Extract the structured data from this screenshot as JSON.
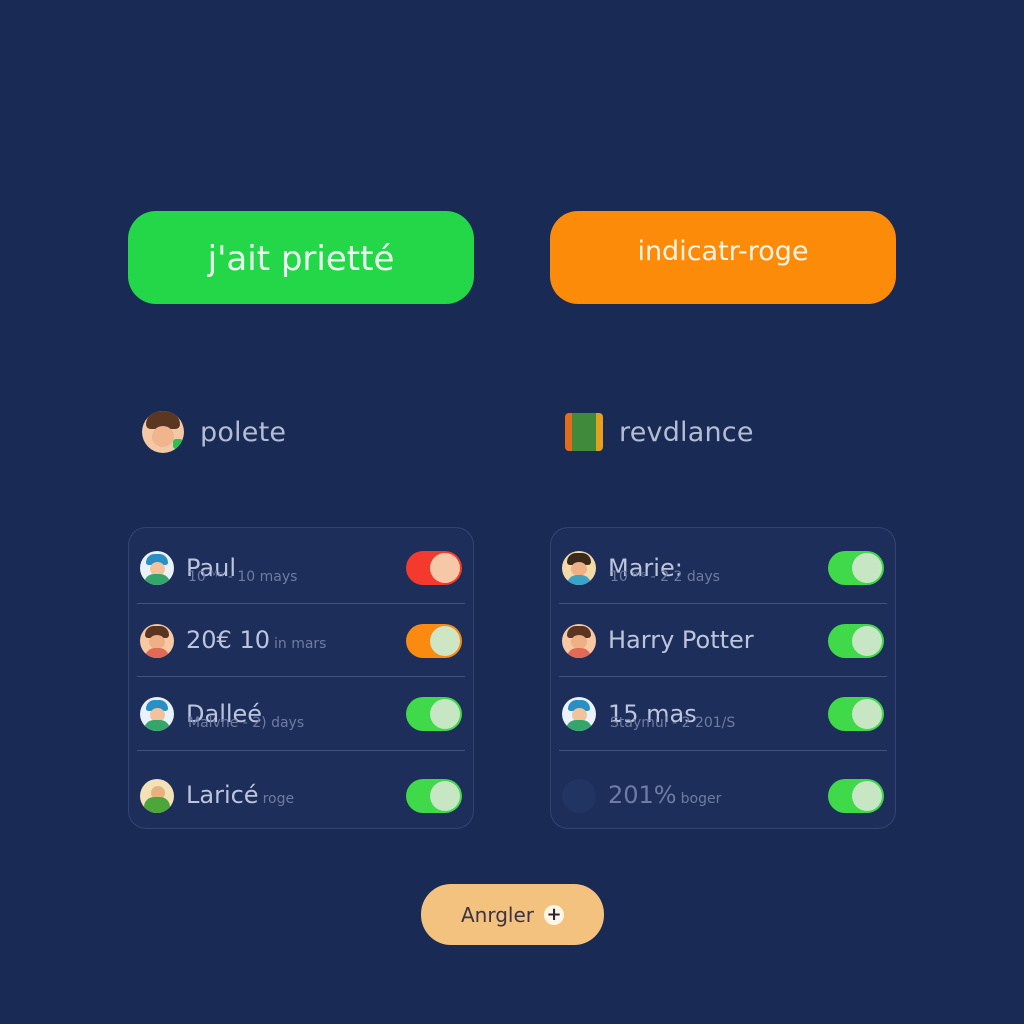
{
  "buttons": {
    "green_label": "j'ait prietté",
    "orange_label": "indicatr-roge",
    "add_label": "Anrgler",
    "add_icon": "+"
  },
  "sections": {
    "left_title": "polete",
    "right_title": "revdlance"
  },
  "left_list": [
    {
      "title": "Paul",
      "subtitle": "10 ᴹⁿ - 10 mays",
      "toggle": "red"
    },
    {
      "title": "20€ 10",
      "subtitle": "in mars",
      "toggle": "orange"
    },
    {
      "title": "Dalleé",
      "subtitle": "Malvne - 2) days",
      "toggle": "green"
    },
    {
      "title": "Laricé",
      "subtitle": "roge",
      "toggle": "green"
    }
  ],
  "right_list": [
    {
      "title": "Marie:",
      "subtitle": "10 ᵐˢ - 2 2 days",
      "toggle": "green"
    },
    {
      "title": "Harry Potter",
      "subtitle": "",
      "toggle": "green"
    },
    {
      "title": "15 mas",
      "subtitle": "Staymul - 2 201/S",
      "toggle": "green"
    },
    {
      "title": "201%",
      "subtitle": "boger",
      "toggle": "green"
    }
  ],
  "colors": {
    "background": "#192a55",
    "green_button": "#23d748",
    "orange_button": "#fd8b0a",
    "add_button": "#f4c27f",
    "toggle_red_track": "#f43a2c",
    "toggle_red_knob": "#f6c8a8",
    "toggle_orange_track": "#fb8a10",
    "toggle_orange_knob": "#cfe6c4",
    "toggle_green_track": "#3fd94a",
    "toggle_green_knob": "#c7e6c4"
  }
}
